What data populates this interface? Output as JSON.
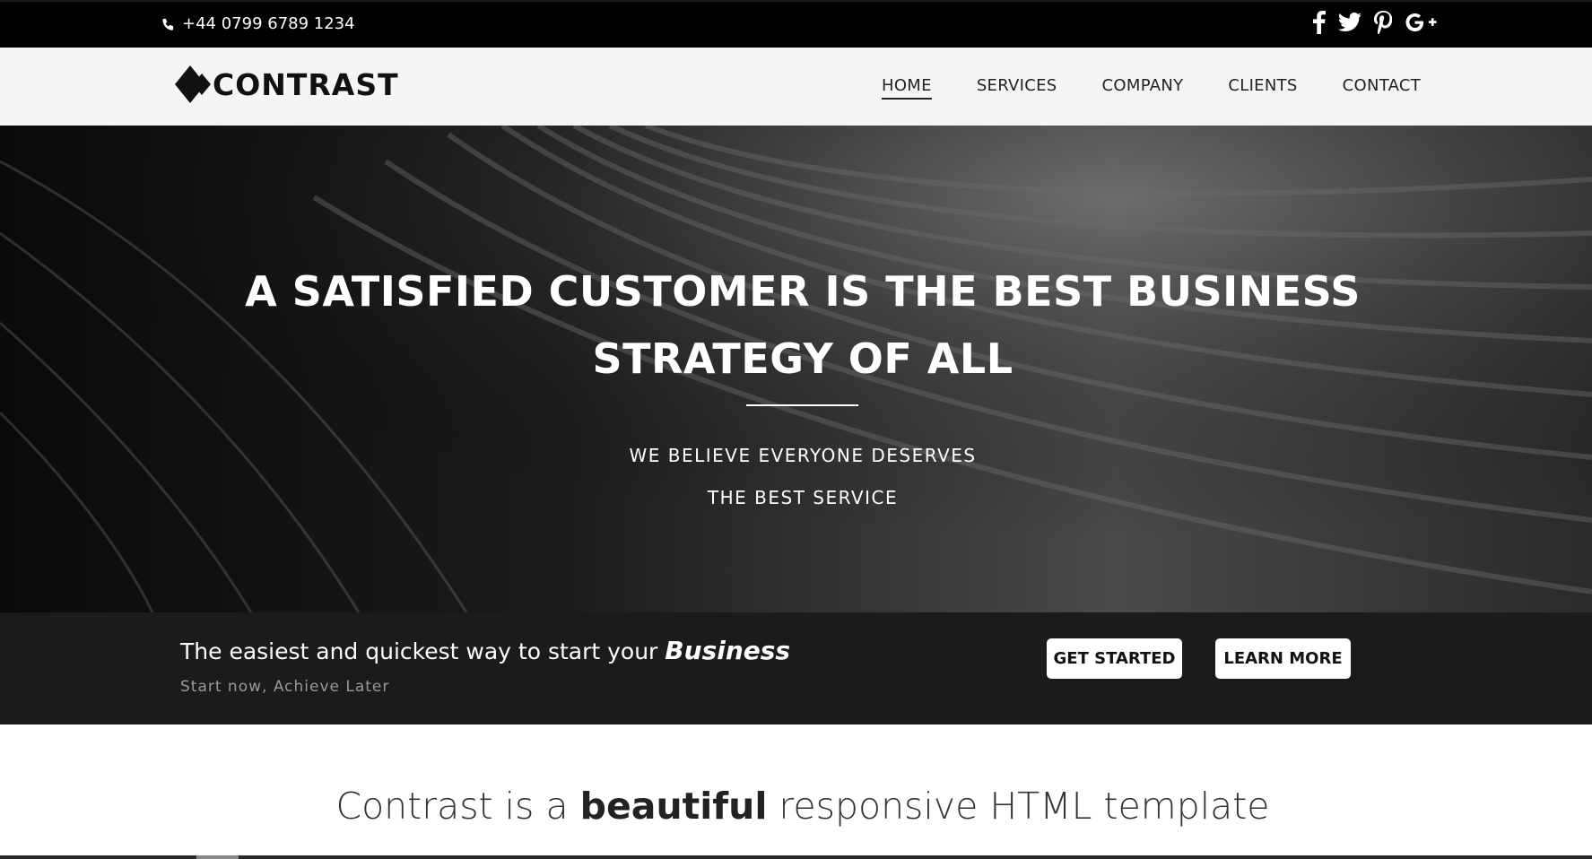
{
  "topbar": {
    "phone_icon": "phone-icon",
    "phone": "+44 0799 6789 1234",
    "socials": [
      {
        "icon": "facebook-icon",
        "label": "f"
      },
      {
        "icon": "twitter-icon",
        "label": "t"
      },
      {
        "icon": "pinterest-icon",
        "label": "P"
      },
      {
        "icon": "google-plus-icon",
        "label": "G+"
      }
    ]
  },
  "navbar": {
    "logo_text": "CONTRAST",
    "items": [
      {
        "label": "HOME",
        "active": true
      },
      {
        "label": "SERVICES",
        "active": false
      },
      {
        "label": "COMPANY",
        "active": false
      },
      {
        "label": "CLIENTS",
        "active": false
      },
      {
        "label": "CONTACT",
        "active": false
      }
    ]
  },
  "hero": {
    "title_line1": "A SATISFIED CUSTOMER IS THE BEST BUSINESS",
    "title_line2": "STRATEGY OF ALL",
    "subtitle_line1": "WE BELIEVE EVERYONE DESERVES",
    "subtitle_line2": "THE BEST SERVICE"
  },
  "cta": {
    "headline_prefix": "The easiest and quickest way to start your",
    "headline_emphasis": "Business",
    "subline": "Start now, Achieve Later",
    "get_started_label": "GET STARTED",
    "learn_more_label": "LEARN MORE"
  },
  "intro": {
    "prefix": "Contrast is a",
    "emphasis": "beautiful",
    "suffix": "responsive HTML template"
  },
  "colors": {
    "topbar_bg": "#000000",
    "navbar_bg": "#f5f5f5",
    "cta_bg": "#1b1b1b",
    "button_bg": "#ffffff"
  }
}
